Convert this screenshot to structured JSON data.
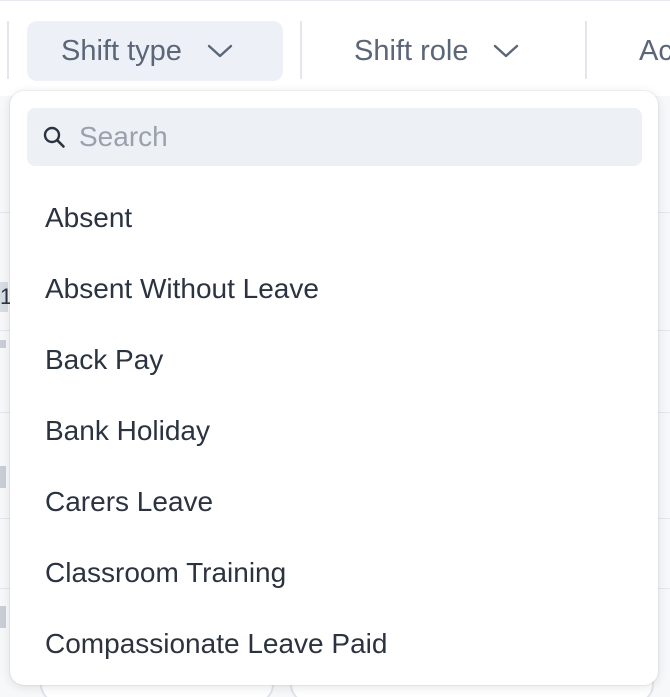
{
  "filter_bar": {
    "shift_type_label": "Shift type",
    "shift_role_label": "Shift role",
    "next_filter_label": "Ac"
  },
  "dropdown": {
    "search_placeholder": "Search",
    "search_value": "",
    "options": [
      "Absent",
      "Absent Without Leave",
      "Back Pay",
      "Bank Holiday",
      "Carers Leave",
      "Classroom Training",
      "Compassionate Leave Paid"
    ]
  },
  "background": {
    "row_fragment_text": "1"
  },
  "colors": {
    "active_filter_bg": "#edf1f7",
    "text": "#2b3340",
    "muted_text": "#5b6678",
    "placeholder": "#9aa1ac"
  },
  "icons": {
    "chevron": "chevron-down-icon",
    "search": "search-icon"
  }
}
